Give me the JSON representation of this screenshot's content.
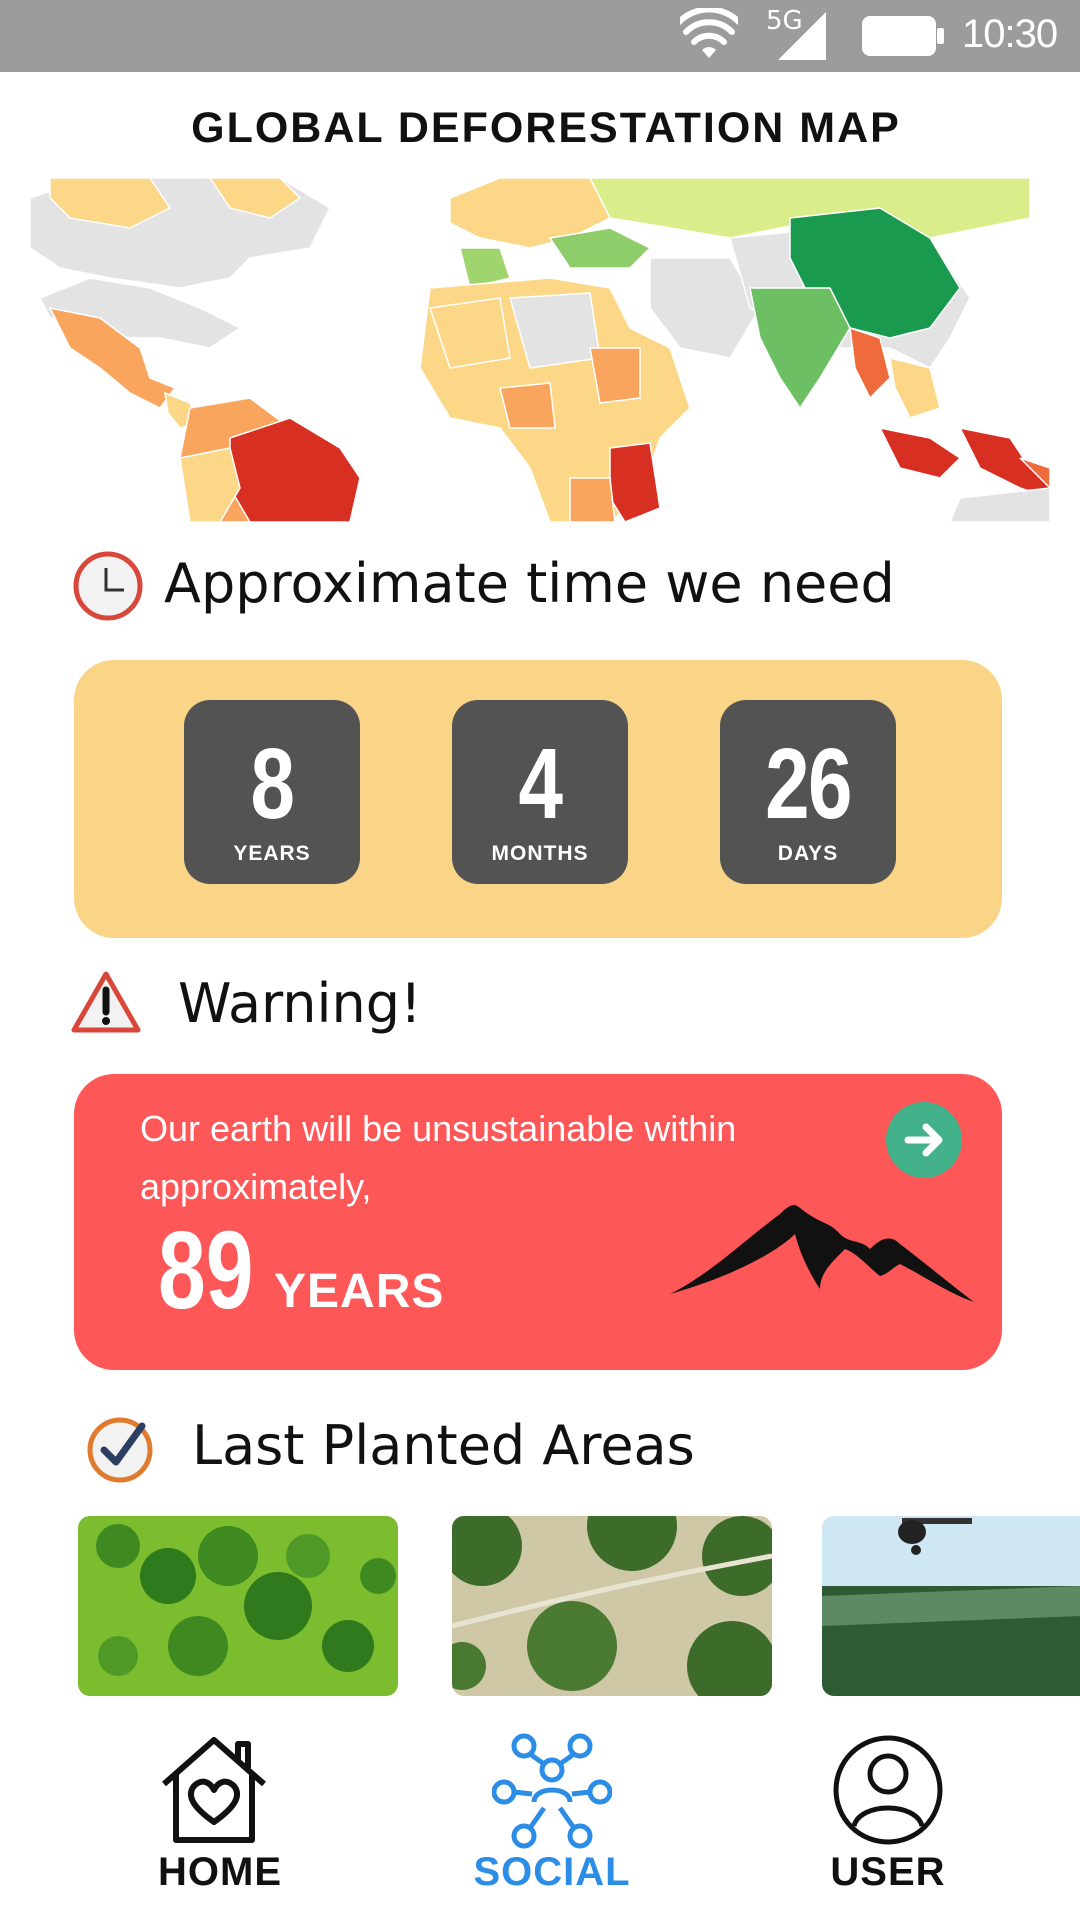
{
  "status_bar": {
    "network": "5G",
    "time": "10:30"
  },
  "page": {
    "title": "GLOBAL DEFORESTATION MAP"
  },
  "time_needed": {
    "heading": "Approximate time we need",
    "icon": "clock-icon",
    "countdown": [
      {
        "value": "8",
        "unit": "YEARS"
      },
      {
        "value": "4",
        "unit": "MONTHS"
      },
      {
        "value": "26",
        "unit": "DAYS"
      }
    ]
  },
  "warning": {
    "heading": "Warning!",
    "icon": "warning-triangle-icon",
    "message": "Our earth will be unsustainable within approximately,",
    "value": "89",
    "unit": "YEARS"
  },
  "planted": {
    "heading": "Last Planted Areas",
    "icon": "check-clock-icon"
  },
  "nav": {
    "items": [
      {
        "label": "HOME",
        "icon": "home-heart-icon",
        "active": false
      },
      {
        "label": "SOCIAL",
        "icon": "social-network-icon",
        "active": true
      },
      {
        "label": "USER",
        "icon": "user-icon",
        "active": false
      }
    ],
    "active_color": "#2b8de6"
  },
  "colors": {
    "countdown_bg": "#fad487",
    "tile_bg": "#535353",
    "warning_bg": "#fe5758",
    "arrow_bg": "#43b28a"
  }
}
